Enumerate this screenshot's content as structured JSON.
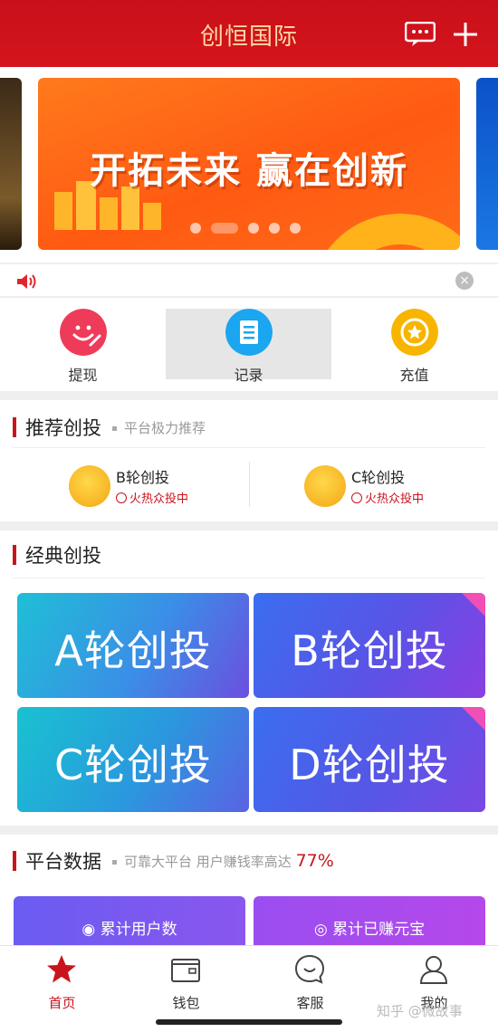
{
  "header": {
    "title": "创恒国际",
    "message_icon": "message-icon",
    "add_icon": "plus-icon"
  },
  "banner": {
    "text": "开拓未来 赢在创新",
    "slides": 5,
    "active_slide": 2
  },
  "quick_actions": [
    {
      "label": "提现",
      "icon": "smile-pen-icon",
      "color": "#ef3b5a"
    },
    {
      "label": "记录",
      "icon": "document-icon",
      "color": "#1aa6f0"
    },
    {
      "label": "充值",
      "icon": "star-icon",
      "color": "#f7b500"
    }
  ],
  "recommend": {
    "title": "推荐创投",
    "subtitle": "平台极力推荐",
    "items": [
      {
        "name": "B轮创投",
        "status": "火热众投中"
      },
      {
        "name": "C轮创投",
        "status": "火热众投中"
      }
    ]
  },
  "classic": {
    "title": "经典创投",
    "cards": [
      "A轮创投",
      "B轮创投",
      "C轮创投",
      "D轮创投"
    ]
  },
  "platform": {
    "title": "平台数据",
    "subtitle": "可靠大平台 用户赚钱率高达",
    "rate": "77%",
    "stats": [
      "累计用户数",
      "累计已赚元宝"
    ]
  },
  "tabs": [
    {
      "label": "首页",
      "icon": "star-icon",
      "active": true
    },
    {
      "label": "钱包",
      "icon": "wallet-icon",
      "active": false
    },
    {
      "label": "客服",
      "icon": "chat-icon",
      "active": false
    },
    {
      "label": "我的",
      "icon": "user-icon",
      "active": false
    }
  ],
  "watermark": "知乎 @微故事",
  "colors": {
    "brand_red": "#c9141c",
    "header_text": "#ffd9a0",
    "banner_orange": "#ff5a12"
  }
}
